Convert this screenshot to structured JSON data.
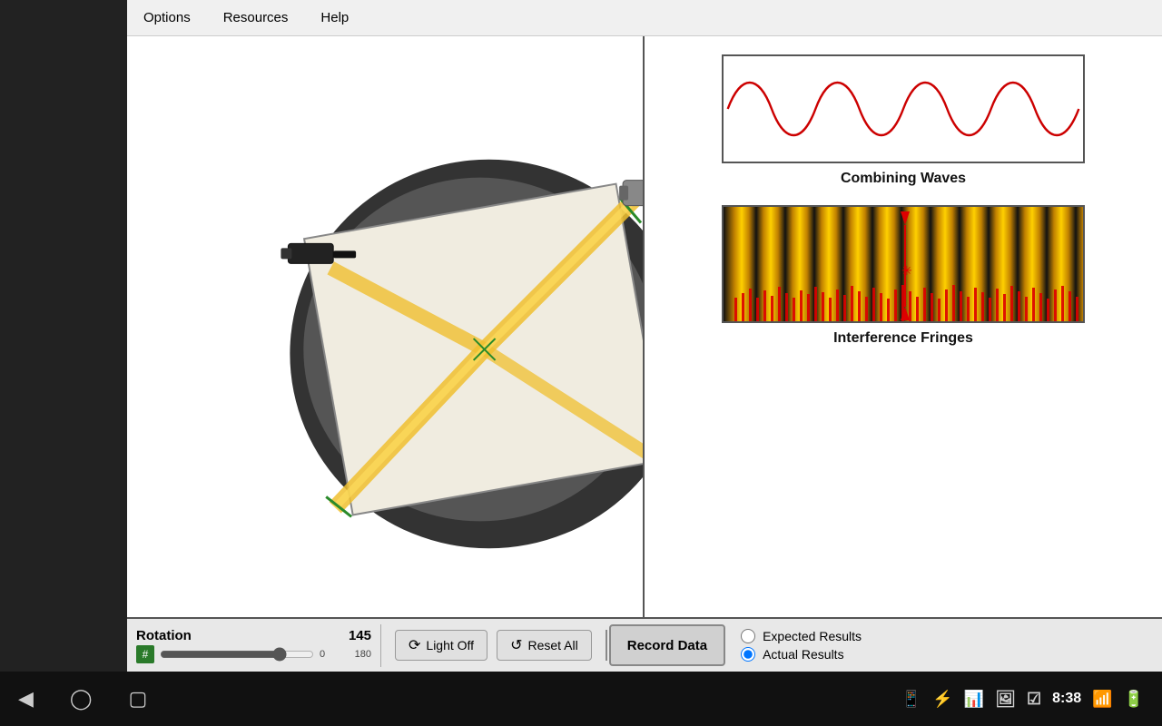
{
  "menu": {
    "items": [
      {
        "label": "Options",
        "id": "options"
      },
      {
        "label": "Resources",
        "id": "resources"
      },
      {
        "label": "Help",
        "id": "help"
      }
    ]
  },
  "rotation": {
    "label": "Rotation",
    "value": "145",
    "min": "0",
    "max": "180"
  },
  "buttons": {
    "light_off": "Light Off",
    "reset_all": "Reset All",
    "record_data": "Record Data"
  },
  "results": {
    "expected_label": "Expected Results",
    "actual_label": "Actual Results",
    "expected_checked": false,
    "actual_checked": true
  },
  "diagrams": {
    "combining_waves_label": "Combining Waves",
    "interference_fringes_label": "Interference Fringes"
  },
  "android_status": {
    "time": "8:38"
  }
}
